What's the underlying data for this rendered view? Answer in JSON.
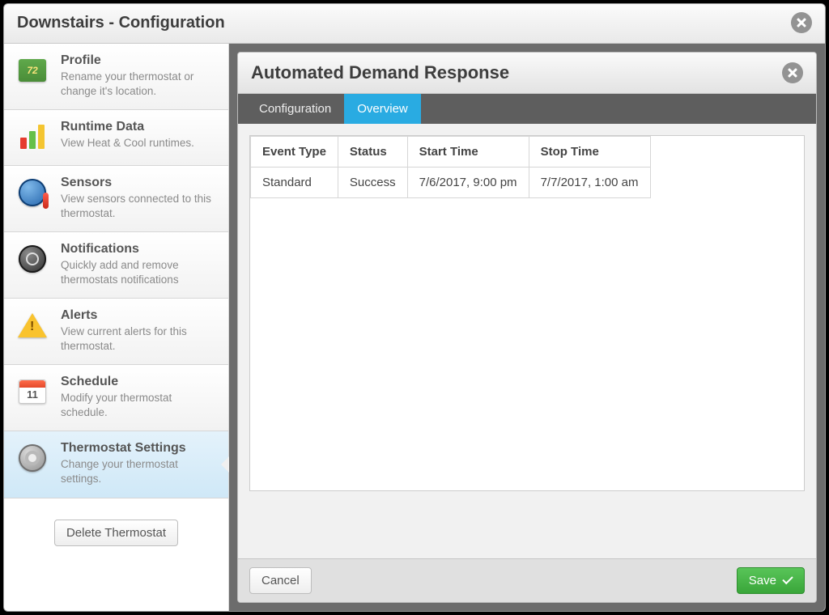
{
  "modal": {
    "title": "Downstairs - Configuration"
  },
  "sidebar": {
    "items": [
      {
        "title": "Profile",
        "desc": "Rename your thermostat or change it's location."
      },
      {
        "title": "Runtime Data",
        "desc": "View Heat & Cool runtimes."
      },
      {
        "title": "Sensors",
        "desc": "View sensors connected to this thermostat."
      },
      {
        "title": "Notifications",
        "desc": "Quickly add and remove thermostats notifications"
      },
      {
        "title": "Alerts",
        "desc": "View current alerts for this thermostat."
      },
      {
        "title": "Schedule",
        "desc": "Modify your thermostat schedule."
      },
      {
        "title": "Thermostat Settings",
        "desc": "Change your thermostat settings."
      }
    ],
    "delete_label": "Delete Thermostat"
  },
  "panel": {
    "title": "Automated Demand Response",
    "tabs": {
      "config": "Configuration",
      "overview": "Overview"
    },
    "table": {
      "headers": {
        "event_type": "Event Type",
        "status": "Status",
        "start": "Start Time",
        "stop": "Stop Time"
      },
      "rows": [
        {
          "event_type": "Standard",
          "status": "Success",
          "start": "7/6/2017, 9:00 pm",
          "stop": "7/7/2017, 1:00 am"
        }
      ]
    },
    "cancel_label": "Cancel",
    "save_label": "Save"
  }
}
